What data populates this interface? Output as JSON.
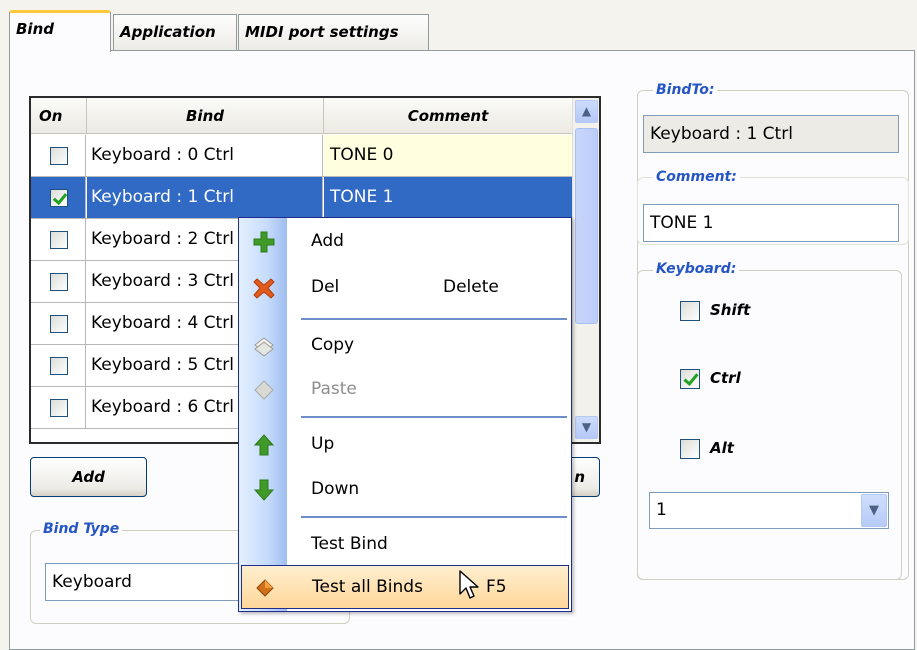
{
  "tabs": [
    {
      "label": "Bind",
      "active": true
    },
    {
      "label": "Application",
      "active": false
    },
    {
      "label": "MIDI port settings",
      "active": false
    }
  ],
  "grid": {
    "columns": [
      "On",
      "Bind",
      "Comment"
    ],
    "rows": [
      {
        "on": false,
        "bind": "Keyboard : 0  Ctrl",
        "comment": "TONE 0",
        "selected": false
      },
      {
        "on": true,
        "bind": "Keyboard : 1  Ctrl",
        "comment": "TONE 1",
        "selected": true
      },
      {
        "on": false,
        "bind": "Keyboard : 2  Ctrl",
        "comment": "",
        "selected": false
      },
      {
        "on": false,
        "bind": "Keyboard : 3  Ctrl",
        "comment": "",
        "selected": false
      },
      {
        "on": false,
        "bind": "Keyboard : 4  Ctrl",
        "comment": "",
        "selected": false
      },
      {
        "on": false,
        "bind": "Keyboard : 5  Ctrl",
        "comment": "",
        "selected": false
      },
      {
        "on": false,
        "bind": "Keyboard : 6  Ctrl",
        "comment": "",
        "selected": false
      }
    ],
    "scroll_up_icon": "chevron-up-icon",
    "scroll_down_icon": "chevron-down-icon"
  },
  "buttons": {
    "add_label": "Add",
    "hidden_button_partial": "n"
  },
  "bind_type": {
    "group_title": "Bind Type",
    "value": "Keyboard"
  },
  "right_panel": {
    "bind_to_title": "BindTo:",
    "bind_to_value": "Keyboard : 1  Ctrl",
    "comment_title": "Comment:",
    "comment_value": "TONE 1",
    "keyboard_title": "Keyboard:",
    "modifiers": [
      {
        "label": "Shift",
        "checked": false
      },
      {
        "label": "Ctrl",
        "checked": true
      },
      {
        "label": "Alt",
        "checked": false
      }
    ],
    "key_value": "1"
  },
  "context_menu": {
    "items": [
      {
        "label": "Add",
        "shortcut": "",
        "icon": "plus-icon",
        "disabled": false,
        "hover": false
      },
      {
        "label": "Del",
        "shortcut": "Delete",
        "icon": "delete-x-icon",
        "disabled": false,
        "hover": false
      },
      {
        "label": "Copy",
        "shortcut": "",
        "icon": "copy-icon",
        "disabled": false,
        "hover": false
      },
      {
        "label": "Paste",
        "shortcut": "",
        "icon": "paste-icon",
        "disabled": true,
        "hover": false
      },
      {
        "label": "Up",
        "shortcut": "",
        "icon": "arrow-up-icon",
        "disabled": false,
        "hover": false
      },
      {
        "label": "Down",
        "shortcut": "",
        "icon": "arrow-down-icon",
        "disabled": false,
        "hover": false
      },
      {
        "label": "Test Bind",
        "shortcut": "",
        "icon": "",
        "disabled": false,
        "hover": false
      },
      {
        "label": "Test all Binds",
        "shortcut": "F5",
        "icon": "test-all-icon",
        "disabled": false,
        "hover": true
      }
    ]
  },
  "colors": {
    "selection": "#316ac5",
    "group_title": "#2555c4",
    "menu_border": "#1f2d8f",
    "active_tab_accent": "#ffc83c",
    "alt_row": "#ffffe0"
  }
}
